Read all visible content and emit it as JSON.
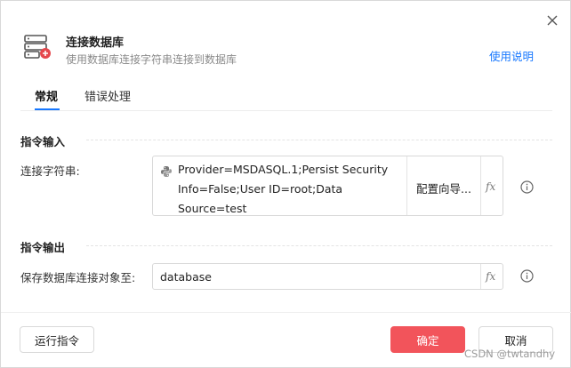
{
  "dialog": {
    "title": "连接数据库",
    "subtitle": "使用数据库连接字符串连接到数据库",
    "help_link": "使用说明",
    "close_icon": "close-icon",
    "header_icon": "database-add-icon"
  },
  "tabs": [
    {
      "label": "常规",
      "active": true
    },
    {
      "label": "错误处理",
      "active": false
    }
  ],
  "input_section": {
    "title": "指令输入",
    "connection_string": {
      "label": "连接字符串:",
      "value_lines": [
        "Provider=MSDASQL.1;Persist Security",
        "Info=False;User ID=root;Data",
        "Source=test"
      ],
      "wizard_label": "配置向导...",
      "fx_label": "fx"
    }
  },
  "output_section": {
    "title": "指令输出",
    "save_to": {
      "label": "保存数据库连接对象至:",
      "value": "database",
      "fx_label": "fx"
    }
  },
  "footer": {
    "run_label": "运行指令",
    "confirm_label": "确定",
    "cancel_label": "取消"
  },
  "watermark": "CSDN @twtandhy",
  "colors": {
    "accent": "#1677ff",
    "primary_button": "#f2545b",
    "icon_red": "#e5484d"
  }
}
